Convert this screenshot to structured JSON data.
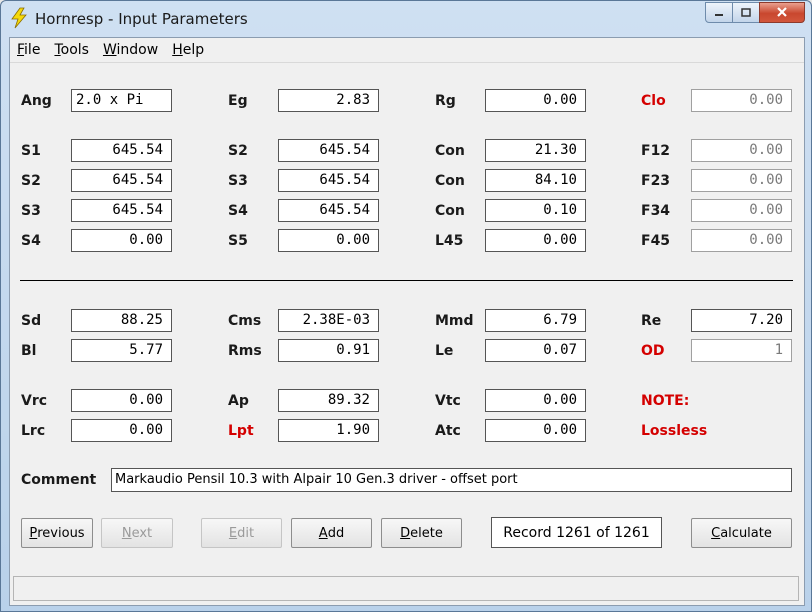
{
  "window": {
    "title": "Hornresp - Input Parameters"
  },
  "menu": [
    {
      "pre": "",
      "key": "F",
      "post": "ile"
    },
    {
      "pre": "",
      "key": "T",
      "post": "ools"
    },
    {
      "pre": "",
      "key": "W",
      "post": "indow"
    },
    {
      "pre": "",
      "key": "H",
      "post": "elp"
    }
  ],
  "params": {
    "ang": {
      "label": "Ang",
      "value": "2.0 x Pi"
    },
    "eg": {
      "label": "Eg",
      "value": "2.83"
    },
    "rg": {
      "label": "Rg",
      "value": "0.00"
    },
    "clo": {
      "label": "Clo",
      "value": "0.00"
    },
    "s1a": {
      "label": "S1",
      "value": "645.54"
    },
    "s2b": {
      "label": "S2",
      "value": "645.54"
    },
    "con1": {
      "label": "Con",
      "value": "21.30"
    },
    "f12": {
      "label": "F12",
      "value": "0.00"
    },
    "s2a": {
      "label": "S2",
      "value": "645.54"
    },
    "s3b": {
      "label": "S3",
      "value": "645.54"
    },
    "con2": {
      "label": "Con",
      "value": "84.10"
    },
    "f23": {
      "label": "F23",
      "value": "0.00"
    },
    "s3a": {
      "label": "S3",
      "value": "645.54"
    },
    "s4b": {
      "label": "S4",
      "value": "645.54"
    },
    "con3": {
      "label": "Con",
      "value": "0.10"
    },
    "f34": {
      "label": "F34",
      "value": "0.00"
    },
    "s4a": {
      "label": "S4",
      "value": "0.00"
    },
    "s5": {
      "label": "S5",
      "value": "0.00"
    },
    "l45": {
      "label": "L45",
      "value": "0.00"
    },
    "f45": {
      "label": "F45",
      "value": "0.00"
    },
    "sd": {
      "label": "Sd",
      "value": "88.25"
    },
    "cms": {
      "label": "Cms",
      "value": "2.38E-03"
    },
    "mmd": {
      "label": "Mmd",
      "value": "6.79"
    },
    "re": {
      "label": "Re",
      "value": "7.20"
    },
    "bl": {
      "label": "Bl",
      "value": "5.77"
    },
    "rms": {
      "label": "Rms",
      "value": "0.91"
    },
    "le": {
      "label": "Le",
      "value": "0.07"
    },
    "od": {
      "label": "OD",
      "value": "1"
    },
    "vrc": {
      "label": "Vrc",
      "value": "0.00"
    },
    "ap": {
      "label": "Ap",
      "value": "89.32"
    },
    "vtc": {
      "label": "Vtc",
      "value": "0.00"
    },
    "lrc": {
      "label": "Lrc",
      "value": "0.00"
    },
    "lpt": {
      "label": "Lpt",
      "value": "1.90"
    },
    "atc": {
      "label": "Atc",
      "value": "0.00"
    }
  },
  "note": {
    "label": "NOTE:",
    "text": "Lossless"
  },
  "comment": {
    "label": "Comment",
    "value": "Markaudio Pensil 10.3 with Alpair 10 Gen.3 driver - offset port"
  },
  "buttons": {
    "previous": {
      "key": "P",
      "rest": "revious"
    },
    "next": {
      "key": "N",
      "rest": "ext"
    },
    "edit": {
      "key": "E",
      "rest": "dit"
    },
    "add": {
      "key": "A",
      "rest": "dd"
    },
    "delete": {
      "key": "D",
      "rest": "elete"
    },
    "calculate": {
      "key": "C",
      "rest": "alculate"
    }
  },
  "record": "Record 1261 of 1261",
  "colors": {
    "accent_red": "#d40000",
    "title_bg": "#c4d8ee"
  }
}
